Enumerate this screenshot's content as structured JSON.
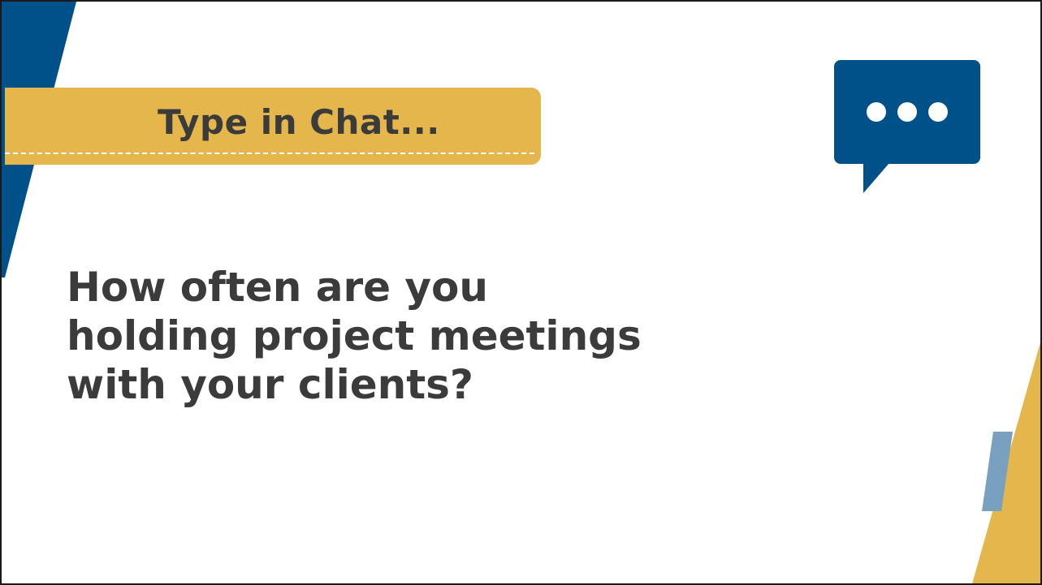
{
  "banner": {
    "label": "Type in Chat..."
  },
  "question": {
    "lines": [
      "How often are you",
      "holding project meetings",
      "with your clients?"
    ]
  },
  "colors": {
    "navy": "#00508a",
    "gold": "#e4b64c",
    "steel_blue": "#7aa0c0",
    "text": "#3b3b3b",
    "background": "#ffffff"
  },
  "icons": {
    "chat": "chat-bubble-ellipsis-icon"
  }
}
